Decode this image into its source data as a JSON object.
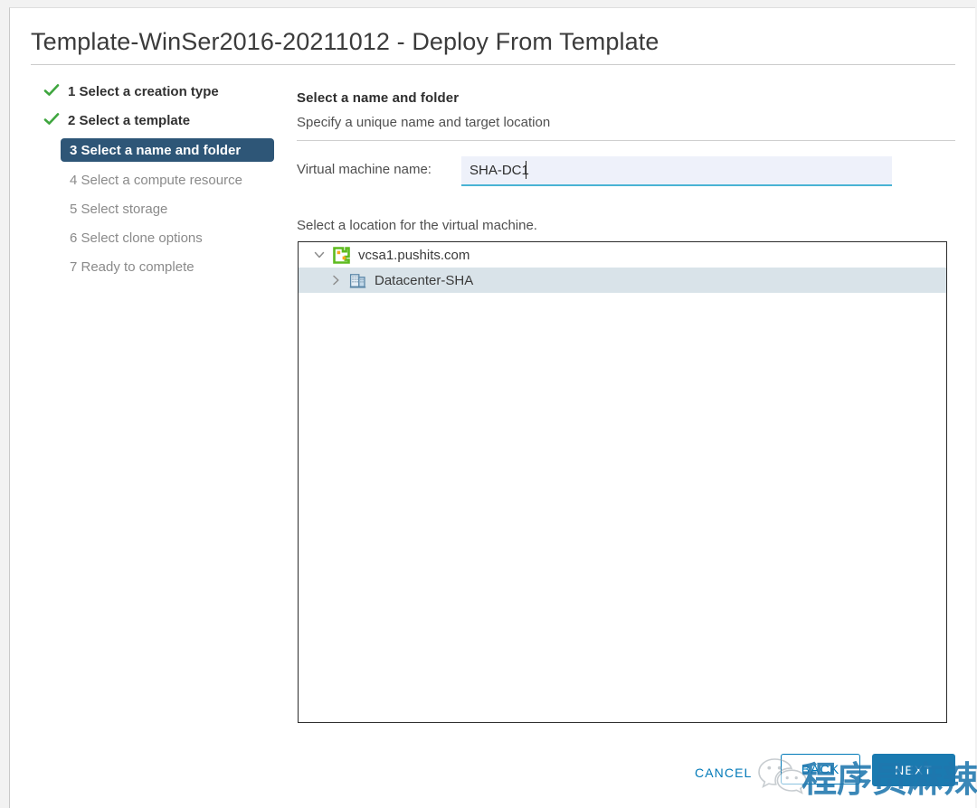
{
  "dialog": {
    "title": "Template-WinSer2016-20211012 - Deploy From Template"
  },
  "sidebar": {
    "steps": [
      {
        "label": "1 Select a creation type",
        "state": "done",
        "icon": "check-icon"
      },
      {
        "label": "2 Select a template",
        "state": "done",
        "icon": "check-icon"
      },
      {
        "label": "3 Select a name and folder",
        "state": "active",
        "icon": ""
      },
      {
        "label": "4 Select a compute resource",
        "state": "pending",
        "icon": ""
      },
      {
        "label": "5 Select storage",
        "state": "pending",
        "icon": ""
      },
      {
        "label": "6 Select clone options",
        "state": "pending",
        "icon": ""
      },
      {
        "label": "7 Ready to complete",
        "state": "pending",
        "icon": ""
      }
    ]
  },
  "main": {
    "title": "Select a name and folder",
    "subtitle": "Specify a unique name and target location",
    "name_label": "Virtual machine name:",
    "vm_name_value": "SHA-DC1",
    "vm_name_placeholder": "",
    "location_label": "Select a location for the virtual machine.",
    "tree": [
      {
        "label": "vcsa1.pushits.com",
        "icon": "vcenter-icon",
        "chevron": "chevron-down-icon",
        "expanded": true,
        "selected": false,
        "level": 0
      },
      {
        "label": "Datacenter-SHA",
        "icon": "datacenter-icon",
        "chevron": "chevron-right-icon",
        "expanded": false,
        "selected": true,
        "level": 1
      }
    ]
  },
  "footer": {
    "cancel_label": "CANCEL",
    "back_label": "BACK",
    "next_label": "NEXT"
  },
  "watermark": {
    "text": "程序员麻辣烫",
    "logo": "wechat-icon"
  },
  "colors": {
    "accent_blue": "#0079b8",
    "active_step_bg": "#2e5677",
    "next_button_bg": "#1a7ab0",
    "check_green": "#3fa63f",
    "input_bg": "#eef1fa",
    "input_underline": "#49b3d4",
    "tree_selected_bg": "#d9e3e9",
    "watermark_blue": "#1f77ae"
  }
}
